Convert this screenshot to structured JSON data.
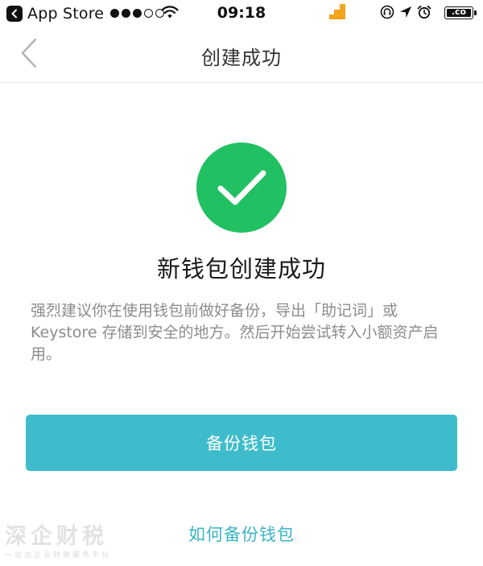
{
  "status_bar": {
    "back_app_label": "App Store",
    "time": "09:18",
    "signal_filled": 3,
    "signal_total": 5,
    "battery_watermark": ".co",
    "icons": [
      "app-back-icon",
      "wifi-icon",
      "orange-app-icon",
      "headphone-icon",
      "location-arrow-icon",
      "alarm-icon",
      "battery-icon"
    ]
  },
  "nav": {
    "title": "创建成功",
    "back_icon": "chevron-left-icon"
  },
  "success": {
    "icon": "check-circle-icon",
    "title": "新钱包创建成功",
    "notice": "强烈建议你在使用钱包前做好备份，导出「助记词」或 Keystore 存储到安全的地方。然后开始尝试转入小额资产启用。"
  },
  "actions": {
    "backup_button": "备份钱包",
    "how_to_backup_link": "如何备份钱包"
  },
  "watermark": {
    "title": "深企财税",
    "subtitle": "一站式企业财税服务平台"
  },
  "colors": {
    "accent": "#3ebccb",
    "link": "#3ab5c4",
    "success": "#21c063",
    "muted_text": "#8c8c8c"
  }
}
